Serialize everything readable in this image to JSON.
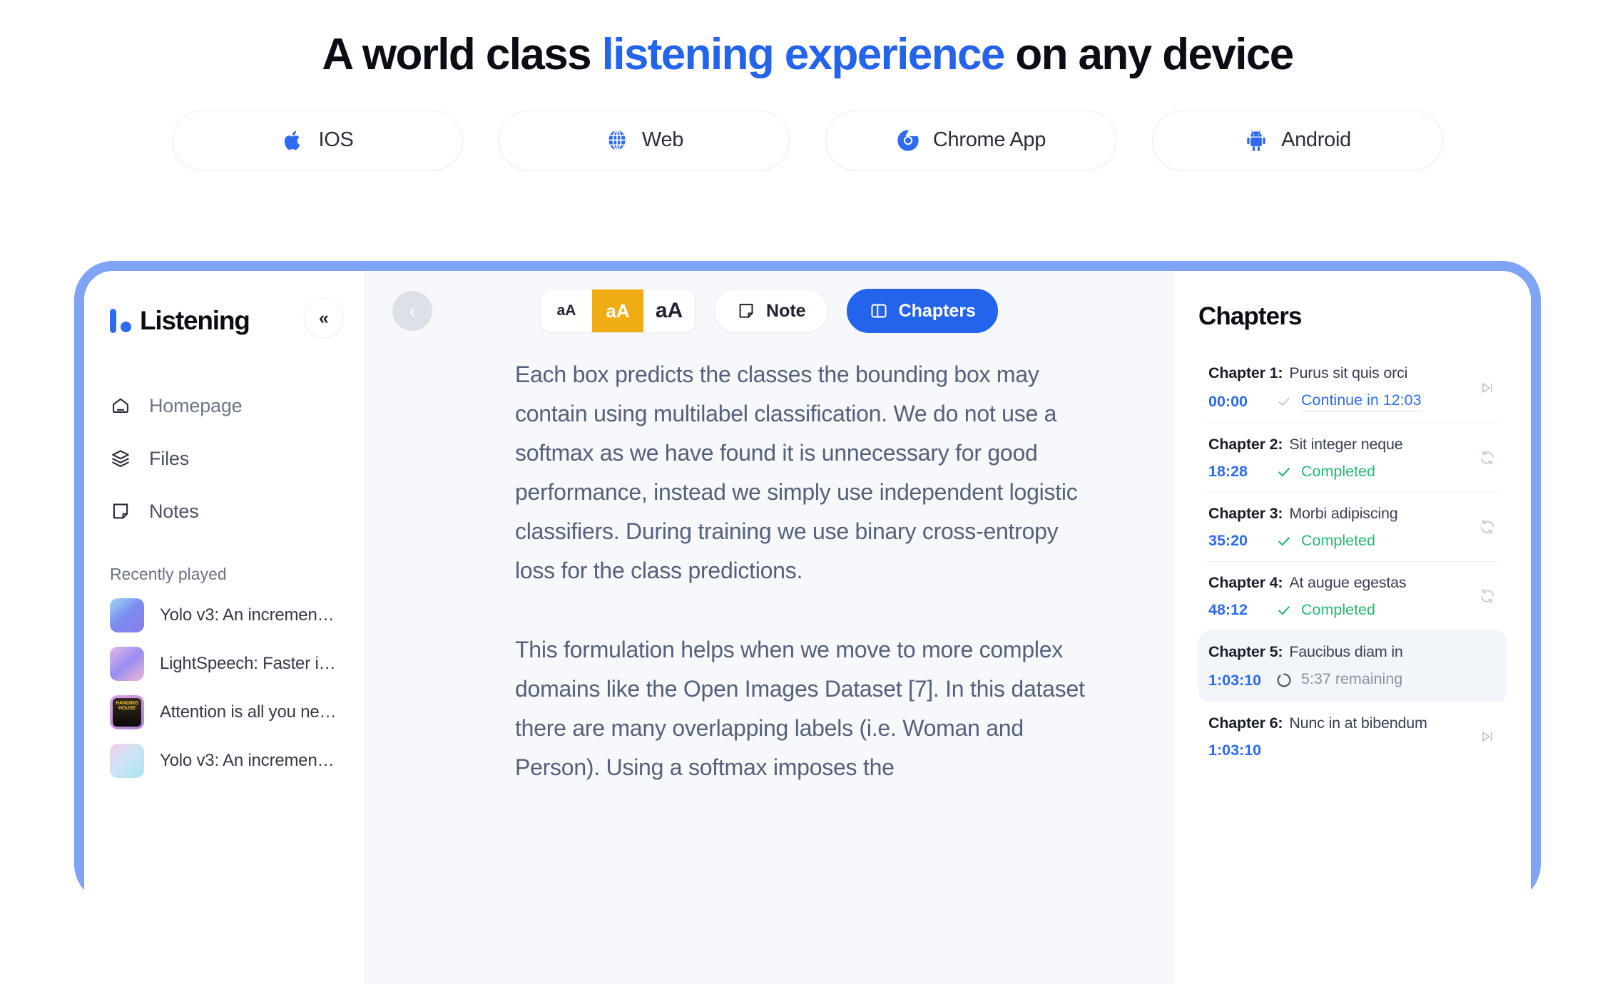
{
  "hero": {
    "headline_before": "A world class ",
    "headline_highlight": "listening experience",
    "headline_after": " on any device",
    "highlight_color": "#2463EB"
  },
  "platforms": [
    {
      "label": "IOS",
      "icon": "apple-icon"
    },
    {
      "label": "Web",
      "icon": "globe-icon"
    },
    {
      "label": "Chrome App",
      "icon": "chrome-icon"
    },
    {
      "label": "Android",
      "icon": "android-icon"
    }
  ],
  "app": {
    "sidebar": {
      "brand": "Listening",
      "collapse_label": "«",
      "nav": [
        {
          "label": "Homepage",
          "icon": "home-icon"
        },
        {
          "label": "Files",
          "icon": "layers-icon"
        },
        {
          "label": "Notes",
          "icon": "note-icon"
        }
      ],
      "recent_title": "Recently played",
      "recent": [
        {
          "label": "Yolo v3: An incremental...",
          "thumb": "gradient-blue-purple"
        },
        {
          "label": "LightSpeech: Faster inf...",
          "thumb": "gradient-pink-purple"
        },
        {
          "label": "Attention is all you need...",
          "thumb": "book-cover-dark",
          "cover_text": "HANGING HOUSE"
        },
        {
          "label": "Yolo v3: An incremental...",
          "thumb": "gradient-pink-cyan"
        }
      ]
    },
    "toolbar": {
      "back_label": "‹",
      "font_sizes": [
        {
          "label": "aA",
          "selected": false
        },
        {
          "label": "aA",
          "selected": true
        },
        {
          "label": "aA",
          "selected": false
        }
      ],
      "font_size_active_color": "#EFAC13",
      "note_label": "Note",
      "chapters_label": "Chapters",
      "chapters_active_color": "#2463EB"
    },
    "document": {
      "paragraphs": [
        "Each box predicts the classes the bounding box may contain using multilabel classification. We do not use a softmax as we have found it is unnecessary for good performance, instead we simply use independent logistic classifiers. During training we use binary cross-entropy loss for the class predictions.",
        "This formulation helps when we move to more complex domains like the Open Images Dataset [7]. In this dataset there are many overlapping labels (i.e. Woman and Person). Using a softmax imposes the"
      ]
    },
    "chapters_panel": {
      "title": "Chapters",
      "items": [
        {
          "number": "Chapter 1:",
          "name": "Purus sit quis orci",
          "time": "00:00",
          "status": "Continue in 12:03",
          "status_type": "continue",
          "right_icon": "skip-next-icon",
          "active": false
        },
        {
          "number": "Chapter 2:",
          "name": "Sit integer neque",
          "time": "18:28",
          "status": "Completed",
          "status_type": "completed",
          "right_icon": "replay-icon",
          "active": false
        },
        {
          "number": "Chapter 3:",
          "name": "Morbi adipiscing",
          "time": "35:20",
          "status": "Completed",
          "status_type": "completed",
          "right_icon": "replay-icon",
          "active": false
        },
        {
          "number": "Chapter 4:",
          "name": "At augue egestas",
          "time": "48:12",
          "status": "Completed",
          "status_type": "completed",
          "right_icon": "replay-icon",
          "active": false
        },
        {
          "number": "Chapter 5:",
          "name": "Faucibus diam in",
          "time": "1:03:10",
          "status": "5:37 remaining",
          "status_type": "remaining",
          "right_icon": "",
          "active": true
        },
        {
          "number": "Chapter 6:",
          "name": "Nunc in at bibendum",
          "time": "1:03:10",
          "status": "",
          "status_type": "none",
          "right_icon": "skip-next-icon",
          "active": false
        }
      ]
    }
  }
}
